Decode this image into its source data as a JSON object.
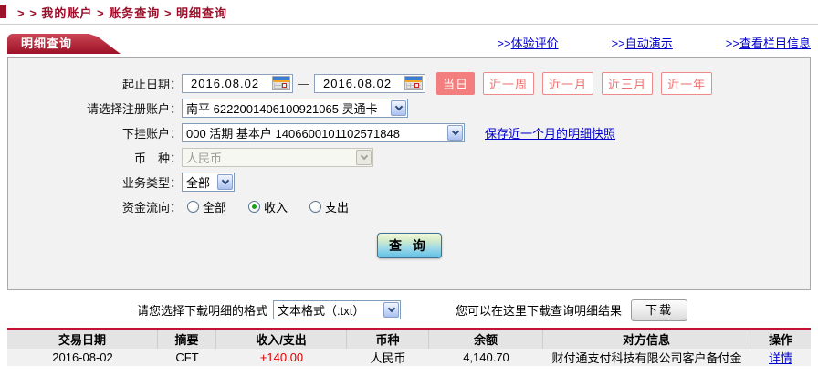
{
  "colors": {
    "accent_red": "#9c1228",
    "link_blue": "#0000cc",
    "amount_red": "#dd0000",
    "salmon": "#f37e7e"
  },
  "breadcrumb": {
    "text": "> > 我的账户 > 账务查询 > 明细查询"
  },
  "header": {
    "tab": "明细查询",
    "links": [
      {
        "prefix": ">>",
        "label": "体验评价"
      },
      {
        "prefix": ">>",
        "label": "自动演示"
      },
      {
        "prefix": ">>",
        "label": "查看栏目信息"
      }
    ]
  },
  "form": {
    "date": {
      "label": "起止日期：",
      "from": "2016.08.02",
      "to": "2016.08.02",
      "separator": "—"
    },
    "quick_buttons": [
      {
        "label": "当日",
        "active": true
      },
      {
        "label": "近一周",
        "active": false
      },
      {
        "label": "近一月",
        "active": false
      },
      {
        "label": "近三月",
        "active": false
      },
      {
        "label": "近一年",
        "active": false
      }
    ],
    "register_account": {
      "label": "请选择注册账户：",
      "value": "南平 6222001406100921065 灵通卡"
    },
    "sub_account": {
      "label": "下挂账户：",
      "value": "000 活期 基本户 1406600101102571848",
      "link": "保存近一个月的明细快照"
    },
    "currency": {
      "label": "币　种：",
      "value": "人民币",
      "disabled": true
    },
    "biz_type": {
      "label": "业务类型：",
      "value": "全部"
    },
    "flow": {
      "label": "资金流向：",
      "options": [
        {
          "label": "全部",
          "checked": false
        },
        {
          "label": "收入",
          "checked": true
        },
        {
          "label": "支出",
          "checked": false
        }
      ]
    },
    "query_button": "查 询"
  },
  "download": {
    "format_label": "请您选择下载明细的格式",
    "format_value": "文本格式（.txt）",
    "hint": "您可以在这里下载查询明细结果",
    "button": "下载"
  },
  "table": {
    "headers": [
      "交易日期",
      "摘要",
      "收入/支出",
      "币种",
      "余额",
      "对方信息",
      "操作"
    ],
    "rows": [
      {
        "date": "2016-08-02",
        "summary": "CFT",
        "amount": "+140.00",
        "currency": "人民币",
        "balance": "4,140.70",
        "counterparty": "财付通支付科技有限公司客户备付金",
        "action": "详情"
      }
    ]
  }
}
